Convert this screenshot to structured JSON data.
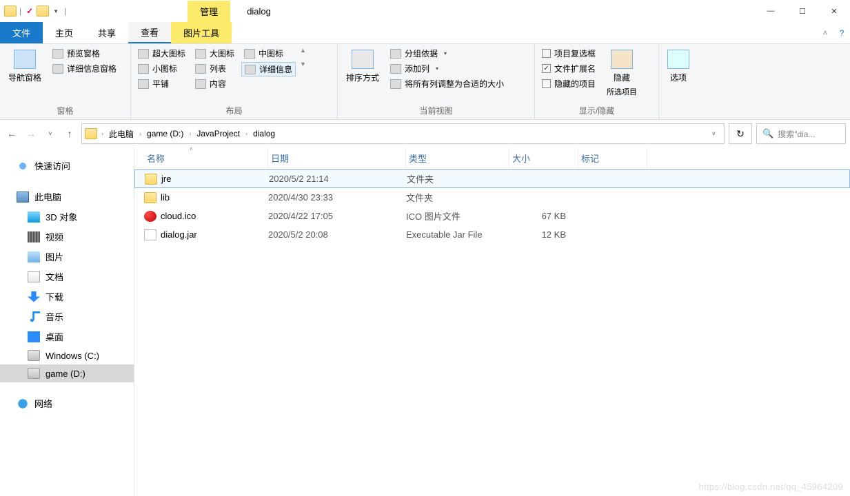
{
  "titlebar": {
    "context_tab": "管理",
    "title": "dialog"
  },
  "tabs": {
    "file": "文件",
    "home": "主页",
    "share": "共享",
    "view": "查看",
    "picture_tools": "图片工具"
  },
  "ribbon": {
    "panes": {
      "nav_pane": "导航窗格",
      "preview_pane": "预览窗格",
      "details_pane": "详细信息窗格",
      "label": "窗格"
    },
    "layout": {
      "extra_large": "超大图标",
      "large": "大图标",
      "medium": "中图标",
      "small": "小图标",
      "list": "列表",
      "details": "详细信息",
      "tiles": "平铺",
      "content": "内容",
      "label": "布局"
    },
    "current_view": {
      "sort": "排序方式",
      "group_by": "分组依据",
      "add_columns": "添加列",
      "size_fit": "将所有列调整为合适的大小",
      "label": "当前视图"
    },
    "show_hide": {
      "item_checkboxes": "项目复选框",
      "file_ext": "文件扩展名",
      "hidden_items": "隐藏的项目",
      "hide_btn": "隐藏",
      "hide_sub": "所选项目",
      "label": "显示/隐藏"
    },
    "options": "选项"
  },
  "breadcrumbs": [
    "此电脑",
    "game (D:)",
    "JavaProject",
    "dialog"
  ],
  "search_placeholder": "搜索\"dia...",
  "sidebar": {
    "quick_access": "快速访问",
    "this_pc": "此电脑",
    "objects_3d": "3D 对象",
    "videos": "视频",
    "pictures": "图片",
    "documents": "文档",
    "downloads": "下载",
    "music": "音乐",
    "desktop": "桌面",
    "drive_c": "Windows (C:)",
    "drive_d": "game (D:)",
    "network": "网络"
  },
  "columns": {
    "name": "名称",
    "date": "日期",
    "type": "类型",
    "size": "大小",
    "tags": "标记"
  },
  "rows": [
    {
      "icon": "folder",
      "name": "jre",
      "date": "2020/5/2 21:14",
      "type": "文件夹",
      "size": "",
      "selected": true
    },
    {
      "icon": "folder",
      "name": "lib",
      "date": "2020/4/30 23:33",
      "type": "文件夹",
      "size": ""
    },
    {
      "icon": "cloud",
      "name": "cloud.ico",
      "date": "2020/4/22 17:05",
      "type": "ICO 图片文件",
      "size": "67 KB"
    },
    {
      "icon": "file",
      "name": "dialog.jar",
      "date": "2020/5/2 20:08",
      "type": "Executable Jar File",
      "size": "12 KB"
    }
  ],
  "watermark": "https://blog.csdn.net/qq_45964209"
}
